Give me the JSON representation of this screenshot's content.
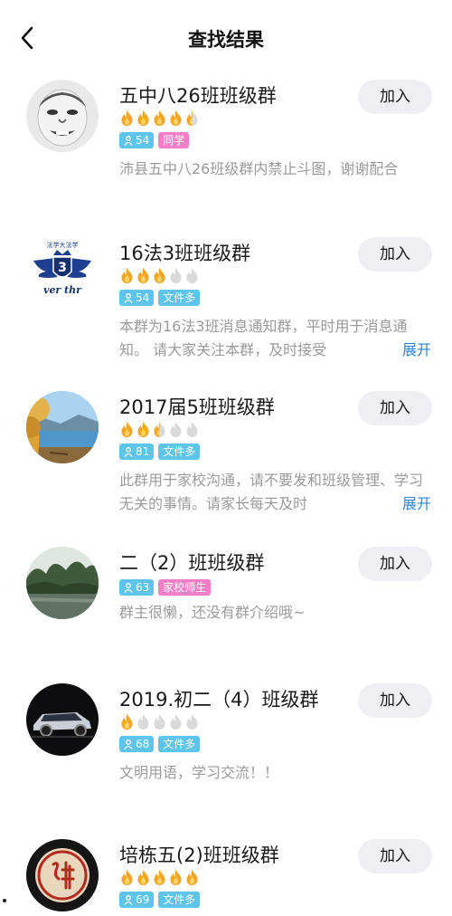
{
  "header": {
    "title": "查找结果",
    "back_icon": "chevron-left-icon"
  },
  "colors": {
    "flame_orange": "#f5a623",
    "flame_gray": "#d9d9d9",
    "tag_blue": "#5ec4ea",
    "tag_pink": "#f77ec6",
    "link_blue": "#2a86d8",
    "button_bg": "#efeff3"
  },
  "groups": [
    {
      "name": "五中八26班班级群",
      "rating": 4.5,
      "members": "54",
      "tag": "同学",
      "tag_color": "pink",
      "description": "沛县五中八26班级群内禁止斗图，谢谢配合",
      "expandable": false,
      "join_label": "加入",
      "avatar_icon": "face-avatar"
    },
    {
      "name": "16法3班班级群",
      "rating": 3,
      "members": "54",
      "tag": "文件多",
      "tag_color": "blue",
      "description": "本群为16法3班消息通知群，平时用于消息通知。 请大家关注本群，及时接受",
      "expandable": true,
      "expand_label": "展开",
      "join_label": "加入",
      "avatar_icon": "crown-wings-logo",
      "avatar_text_top": "法学大法学",
      "avatar_number": "3",
      "avatar_text_bottom": "ver thr"
    },
    {
      "name": "2017届5班班级群",
      "rating": 2.5,
      "members": "81",
      "tag": "文件多",
      "tag_color": "blue",
      "description": "此群用于家校沟通，请不要发和班级管理、学习无关的事情。请家长每天及时",
      "expandable": true,
      "expand_label": "展开",
      "join_label": "加入",
      "avatar_icon": "lake-landscape"
    },
    {
      "name": "二（2）班班级群",
      "rating": 0,
      "members": "63",
      "tag": "家校师生",
      "tag_color": "pink",
      "description": "群主很懒，还没有群介绍哦~",
      "expandable": false,
      "join_label": "加入",
      "avatar_icon": "forest-landscape"
    },
    {
      "name": "2019.初二（4）班级群",
      "rating": 1,
      "members": "68",
      "tag": "文件多",
      "tag_color": "blue",
      "description": "文明用语，学习交流！！",
      "expandable": false,
      "join_label": "加入",
      "avatar_icon": "car-photo"
    },
    {
      "name": "培栋五(2)班班级群",
      "rating": 5,
      "members": "69",
      "tag": "文件多",
      "tag_color": "blue",
      "description": "",
      "expandable": false,
      "join_label": "加入",
      "avatar_icon": "seal-stamp"
    }
  ]
}
